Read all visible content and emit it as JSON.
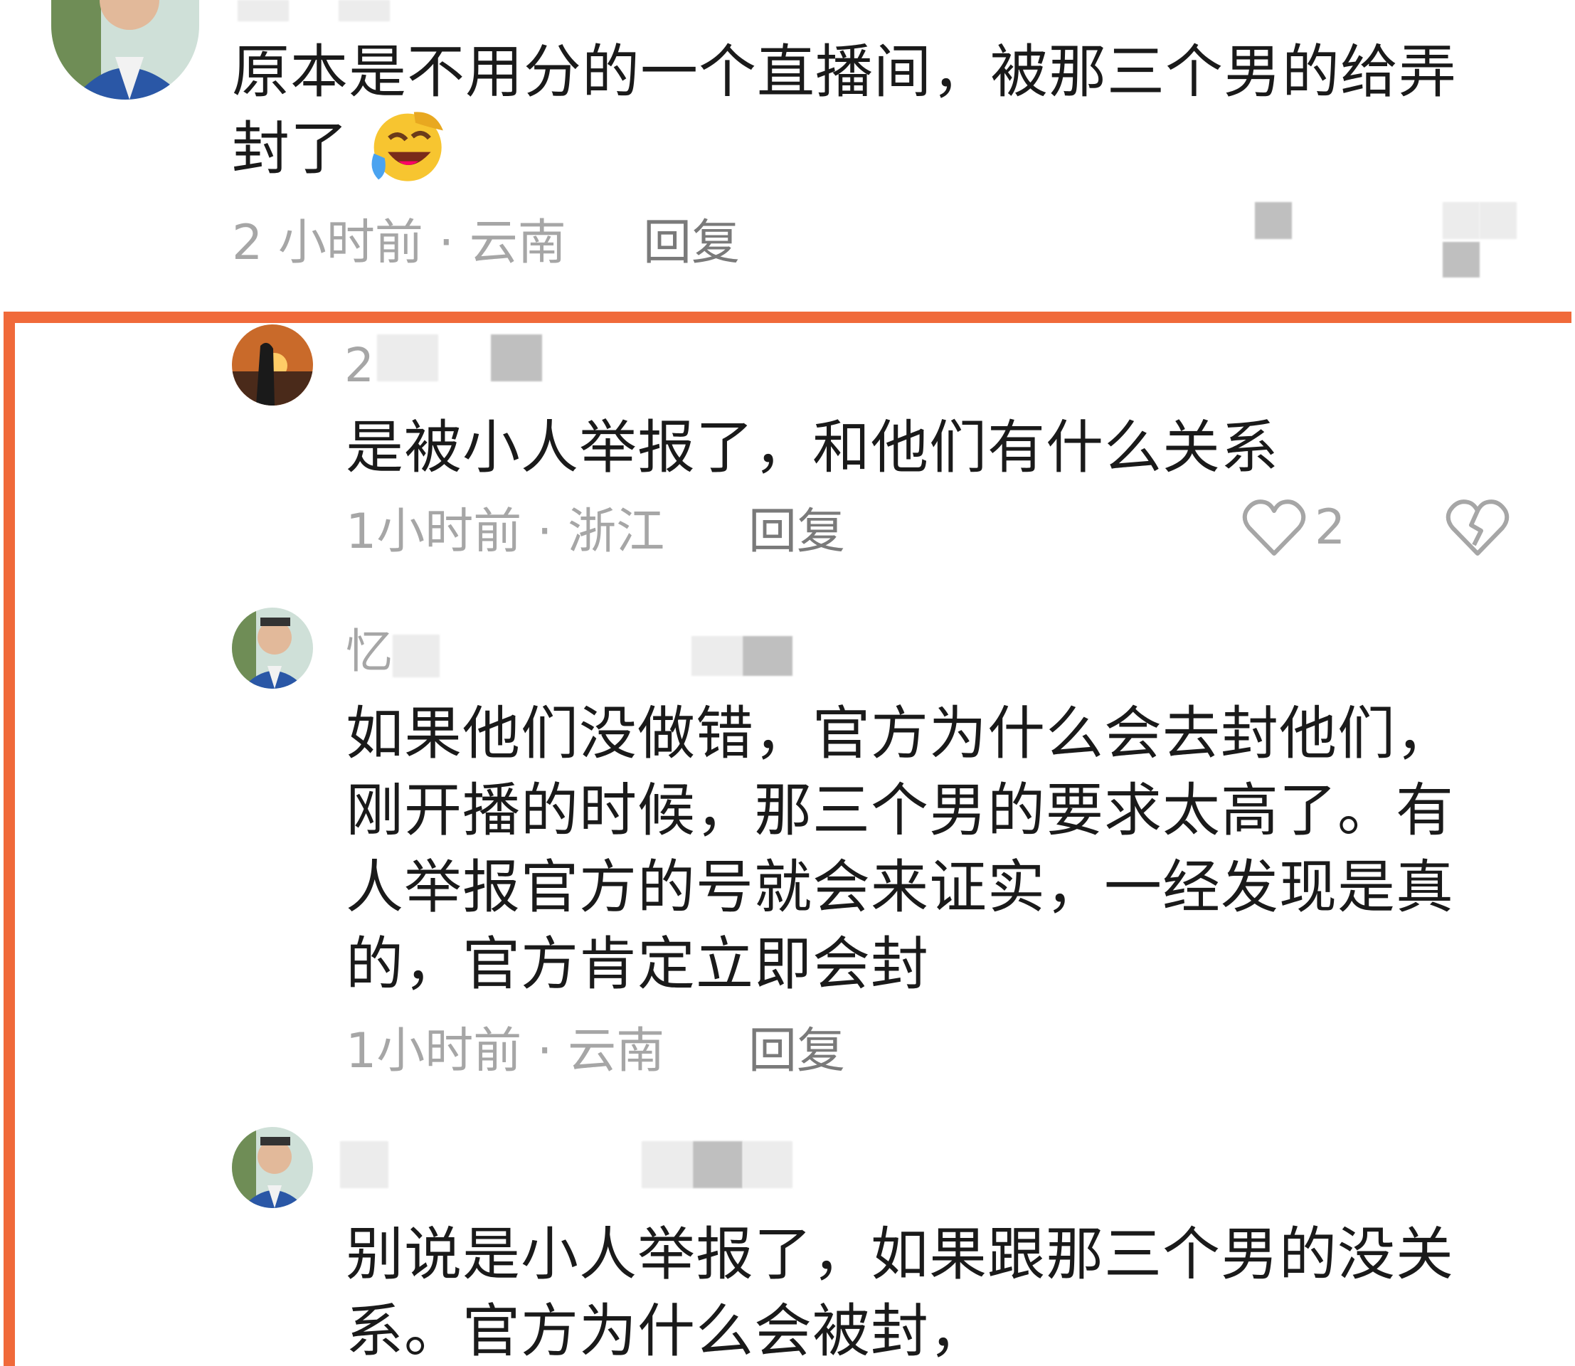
{
  "comments": [
    {
      "text_line1": "原本是不用分的一个直播间，被那三个男的给弄",
      "text_line2": "封了",
      "emoji": "laughing-crying-emoji",
      "meta": "2 小时前 · 云南",
      "reply_label": "回复"
    },
    {
      "name_visible": "2",
      "text": "是被小人举报了，和他们有什么关系",
      "meta": "1小时前 · 浙江",
      "reply_label": "回复",
      "like_count": "2",
      "like_icon": "heart-outline-icon",
      "dislike_icon": "broken-heart-icon"
    },
    {
      "name_visible": "忆",
      "lines": [
        "如果他们没做错，官方为什么会去封他们，",
        "刚开播的时候，那三个男的要求太高了。有",
        "人举报官方的号就会来证实，一经发现是真",
        "的，官方肯定立即会封"
      ],
      "meta": "1小时前 · 云南",
      "reply_label": "回复"
    },
    {
      "lines": [
        "别说是小人举报了，如果跟那三个男的没关",
        "系。官方为什么会被封，"
      ]
    }
  ],
  "colors": {
    "highlight": "#f06a3a",
    "meta_gray": "#a6a6a6",
    "text": "#1a1a1a"
  }
}
